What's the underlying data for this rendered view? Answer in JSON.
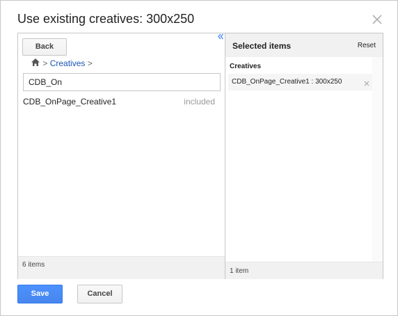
{
  "dialog": {
    "title": "Use existing creatives: 300x250"
  },
  "browser": {
    "back_label": "Back",
    "breadcrumb": {
      "separator_1": ">",
      "folder": "Creatives",
      "separator_2": ">"
    },
    "search": {
      "value": "CDB_On",
      "placeholder": ""
    },
    "results": [
      {
        "name": "CDB_OnPage_Creative1",
        "status": "included"
      }
    ],
    "footer_count": "6 items"
  },
  "selected": {
    "header": "Selected items",
    "reset_label": "Reset",
    "group": "Creatives",
    "items": [
      {
        "name": "CDB_OnPage_Creative1 : 300x250",
        "remove": "×"
      }
    ],
    "footer_count": "1 item"
  },
  "actions": {
    "save_label": "Save",
    "cancel_label": "Cancel"
  },
  "icons": {
    "close": "close-icon",
    "home": "home-icon",
    "collapse": "double-chevron-left-icon",
    "remove": "close-icon"
  },
  "colors": {
    "accent": "#4d90fe",
    "link": "#1a54b5",
    "muted": "#999999",
    "panel_bg": "#f1f1f1"
  }
}
